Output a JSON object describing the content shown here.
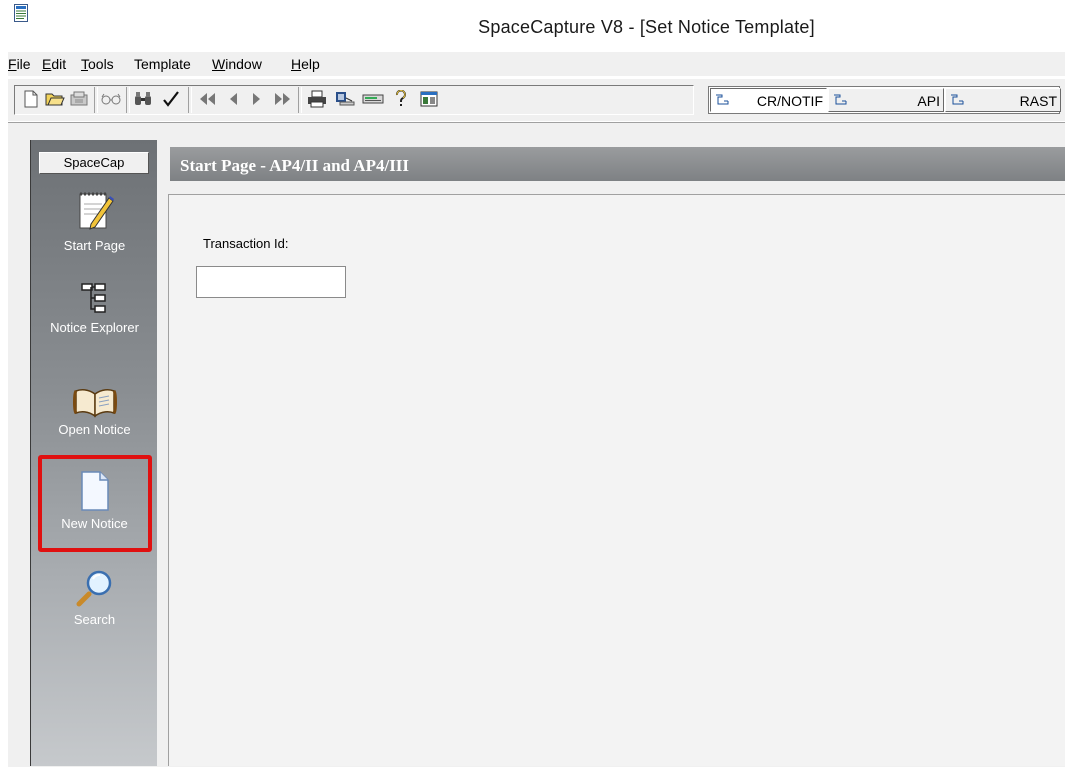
{
  "window": {
    "title": "SpaceCapture V8 - [Set Notice Template]"
  },
  "menu": [
    {
      "key": "F",
      "rest": "ile"
    },
    {
      "key": "E",
      "rest": "dit"
    },
    {
      "key": "T",
      "rest": "ools"
    },
    {
      "key": "",
      "rest": "Template"
    },
    {
      "key": "W",
      "rest": "indow"
    },
    {
      "key": "H",
      "rest": "elp"
    }
  ],
  "toolbar": {
    "icons": [
      "new-doc-icon",
      "open-folder-icon",
      "save-icon",
      "glasses-icon",
      "binoculars-icon",
      "checkmark-icon",
      "first-icon",
      "previous-icon",
      "next-icon",
      "last-icon",
      "print-icon",
      "export-icon",
      "database-icon",
      "help-icon",
      "window-icon"
    ],
    "templates": [
      "CR/NOTIF",
      "API",
      "RAST"
    ]
  },
  "sidebar": {
    "header": "SpaceCap",
    "items": [
      {
        "label": "Start Page",
        "icon": "notepad-pencil-icon"
      },
      {
        "label": "Notice Explorer",
        "icon": "tree-icon"
      },
      {
        "label": "Open Notice",
        "icon": "open-book-icon"
      },
      {
        "label": "New Notice",
        "icon": "blank-page-icon"
      },
      {
        "label": "Search",
        "icon": "magnifier-icon"
      }
    ],
    "highlight_color": "#e01010"
  },
  "main": {
    "title": "Start Page - AP4/II and AP4/III",
    "transaction_label": "Transaction Id:",
    "transaction_value": ""
  }
}
